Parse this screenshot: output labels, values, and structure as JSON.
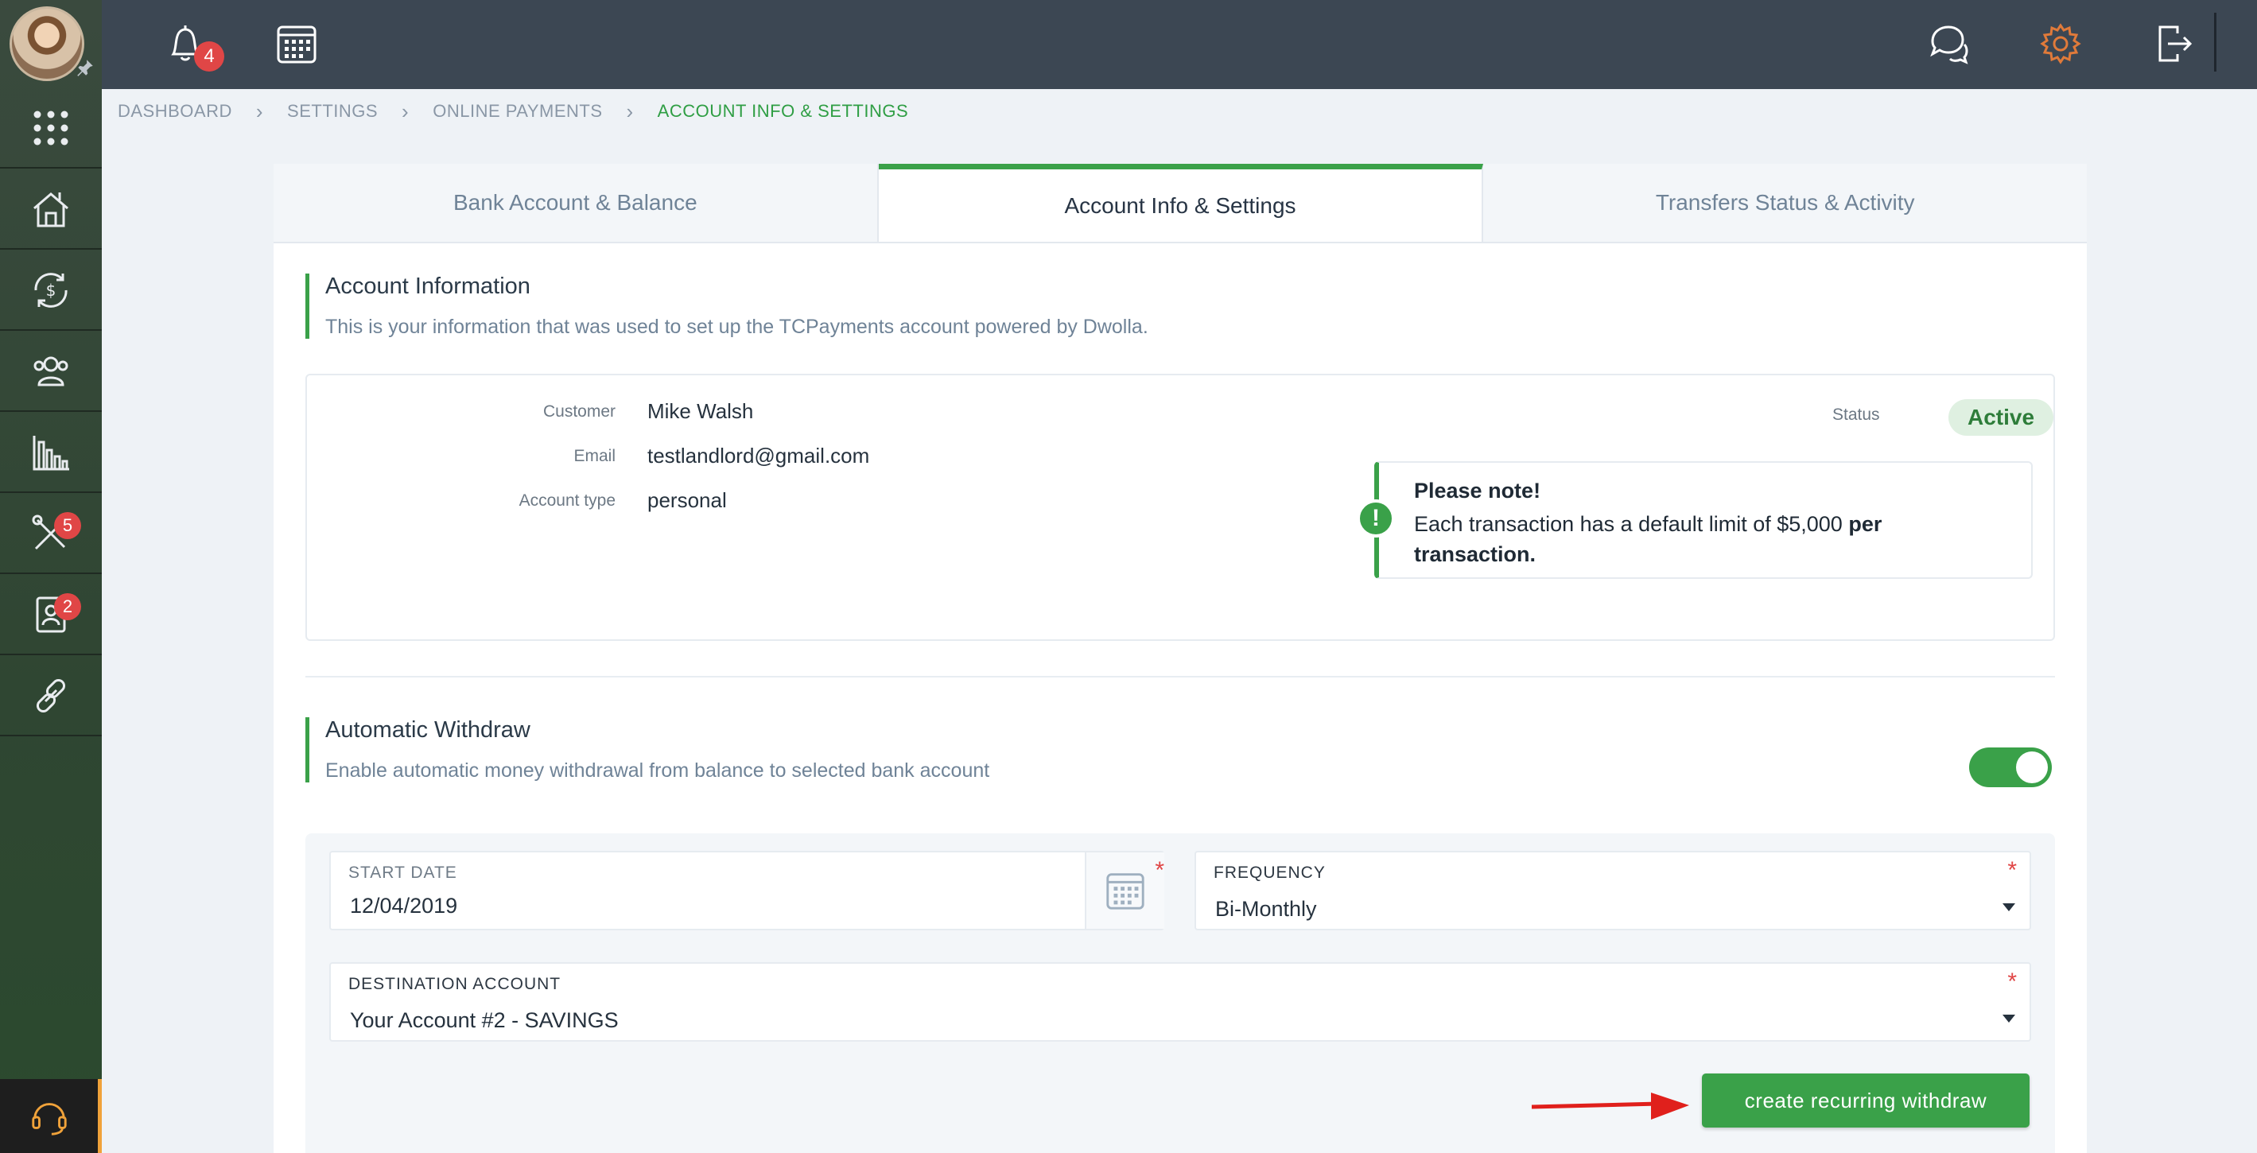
{
  "topbar": {
    "notifications_count": "4"
  },
  "sidebar": {
    "tools_badge": "5",
    "applicants_badge": "2"
  },
  "breadcrumb": {
    "items": [
      "DASHBOARD",
      "SETTINGS",
      "ONLINE PAYMENTS",
      "ACCOUNT INFO & SETTINGS"
    ]
  },
  "tabs": [
    {
      "label": "Bank Account & Balance"
    },
    {
      "label": "Account Info & Settings"
    },
    {
      "label": "Transfers Status & Activity"
    }
  ],
  "account_info": {
    "title": "Account Information",
    "subtitle": "This is your information that was used to set up the TCPayments account powered by Dwolla.",
    "customer_label": "Customer",
    "customer_value": "Mike Walsh",
    "email_label": "Email",
    "email_value": "testlandlord@gmail.com",
    "account_type_label": "Account type",
    "account_type_value": "personal",
    "status_label": "Status",
    "status_value": "Active",
    "note_title": "Please note!",
    "note_body": "Each transaction has a default limit of $5,000",
    "note_bold": "per transaction."
  },
  "auto_withdraw": {
    "title": "Automatic Withdraw",
    "subtitle": "Enable automatic money withdrawal from balance to selected bank account",
    "enabled": true,
    "start_date_label": "START DATE",
    "start_date_value": "12/04/2019",
    "frequency_label": "FREQUENCY",
    "frequency_value": "Bi-Monthly",
    "destination_label": "DESTINATION ACCOUNT",
    "destination_value": "Your Account #2 - SAVINGS",
    "required_mark": "*",
    "submit_label": "create recurring withdraw"
  },
  "colors": {
    "accent": "#3aa149",
    "topbar": "#3c4753",
    "badge": "#e04646",
    "settings_icon": "#e07a3a"
  }
}
